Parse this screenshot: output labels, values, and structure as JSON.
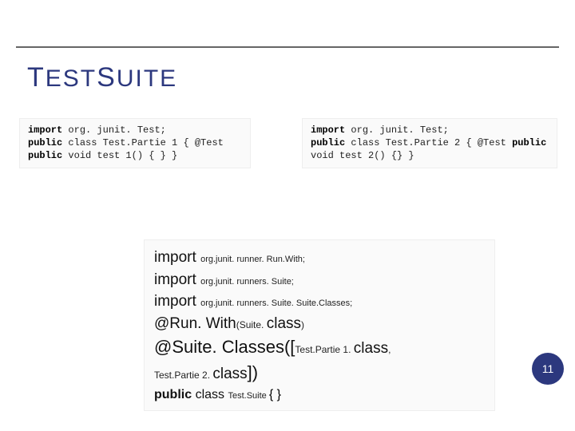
{
  "title": {
    "segments": [
      "T",
      "EST",
      "S",
      "UITE"
    ]
  },
  "codeLeft": {
    "l1": {
      "kw": "import",
      "rest": " org. junit. Test;"
    },
    "l2": {
      "kw": "public",
      "rest": " class Test.Partie 1 { @Test"
    },
    "l3": {
      "kw": "public",
      "rest": " void test 1() { } }"
    }
  },
  "codeRight": {
    "l1": {
      "kw": "import",
      "rest": " org. junit. Test;"
    },
    "l2": {
      "kw1": "public",
      "mid": " class Test.Partie 2 { @Test ",
      "kw2": "public"
    },
    "l3": {
      "rest": "void test 2() {} }"
    }
  },
  "suite": {
    "l1": {
      "big": "import ",
      "small": "org.junit. runner. Run.With;"
    },
    "l2": {
      "big": "import ",
      "small": "org.junit. runners. Suite;"
    },
    "l3": {
      "big": "import ",
      "small": "org.junit. runners. Suite. Suite.Classes;"
    },
    "l4": {
      "run": "@Run. With",
      "paren": "(Suite. ",
      "cls": "class",
      "close": ")"
    },
    "l5": {
      "big": "@Suite. Classes",
      "open": "([",
      "name": "Test.Partie 1. ",
      "cls": "class",
      "comma": ","
    },
    "l6": {
      "name": "Test.Partie 2. ",
      "cls": "class",
      "close": "])"
    },
    "l7": {
      "pub": "public ",
      "classkw": "class ",
      "name": "Test.Suite ",
      "braces": "{ }"
    }
  },
  "pageNumber": "11"
}
